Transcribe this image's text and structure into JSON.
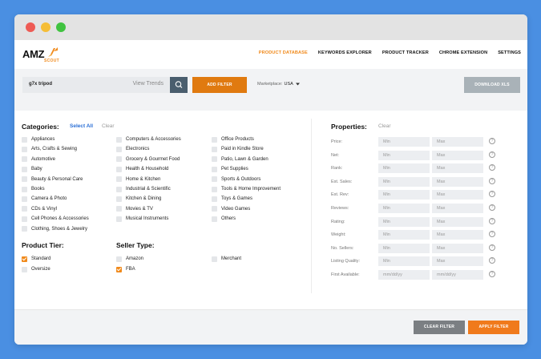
{
  "window": {
    "controls": [
      "close",
      "minimize",
      "maximize"
    ]
  },
  "logo": {
    "text_main": "AMZ",
    "text_sub": "SCOUT"
  },
  "nav": {
    "items": [
      {
        "label": "PRODUCT DATABASE",
        "active": true
      },
      {
        "label": "KEYWORDS EXPLORER",
        "active": false
      },
      {
        "label": "PRODUCT TRACKER",
        "active": false
      },
      {
        "label": "CHROME EXTENSION",
        "active": false
      },
      {
        "label": "SETTINGS",
        "active": false
      }
    ]
  },
  "search": {
    "value": "g7x tripod",
    "view_trends": "View Trends",
    "icon": "search-icon",
    "add_filter": "ADD FILTER",
    "marketplace_label": "Marketplace:",
    "marketplace_value": "USA",
    "download": "DOWNLOAD XLS"
  },
  "categories": {
    "title": "Categories:",
    "select_all": "Select All",
    "clear": "Clear",
    "col1": [
      "Appliances",
      "Arts, Crafts & Sewing",
      "Automotive",
      "Baby",
      "Beauty & Personal Care",
      "Books",
      "Camera & Photo",
      "CDs & Vinyl",
      "Cell Phones & Accessories",
      "Clothing, Shoes & Jewelry"
    ],
    "col2": [
      "Computers & Accessories",
      "Electronics",
      "Grocery & Gourmet Food",
      "Health & Household",
      "Home & Kitchen",
      "Industrial & Scientific",
      "Kitchen & Dining",
      "Movies & TV",
      "Musical Instruments"
    ],
    "col3": [
      "Office Products",
      "Paid in Kindle Store",
      "Patio, Lawn & Garden",
      "Pet Supplies",
      "Sports & Outdoors",
      "Tools & Home Improvement",
      "Toys & Games",
      "Video Games",
      "Others"
    ]
  },
  "product_tier": {
    "title": "Product Tier:",
    "items": [
      {
        "label": "Standard",
        "checked": true
      },
      {
        "label": "Oversize",
        "checked": false
      }
    ]
  },
  "seller_type": {
    "title": "Seller Type:",
    "items": [
      {
        "label": "Amazon",
        "checked": false
      },
      {
        "label": "FBA",
        "checked": true
      },
      {
        "label": "Merchant",
        "checked": false
      }
    ]
  },
  "properties": {
    "title": "Properties:",
    "clear": "Clear",
    "rows": [
      {
        "label": "Price:",
        "min": "Min",
        "max": "Max"
      },
      {
        "label": "Net:",
        "min": "Min",
        "max": "Max"
      },
      {
        "label": "Rank:",
        "min": "Min",
        "max": "Max"
      },
      {
        "label": "Est. Sales:",
        "min": "Min",
        "max": "Max"
      },
      {
        "label": "Est. Rev:",
        "min": "Min",
        "max": "Max"
      },
      {
        "label": "Reviews:",
        "min": "Min",
        "max": "Max"
      },
      {
        "label": "Rating:",
        "min": "Min",
        "max": "Max"
      },
      {
        "label": "Weight:",
        "min": "Min",
        "max": "Max"
      },
      {
        "label": "No. Sellers:",
        "min": "Min",
        "max": "Max"
      },
      {
        "label": "Listing Quality:",
        "min": "Min",
        "max": "Max"
      },
      {
        "label": "First Available:",
        "min": "mm/dd/yy",
        "max": "mm/dd/yy"
      }
    ],
    "help_glyph": "?"
  },
  "footer": {
    "clear_filter": "CLEAR FILTER",
    "apply_filter": "APPLY FILTER"
  },
  "colors": {
    "accent": "#f08a1c",
    "link": "#2a6fd6",
    "background": "#4a8fe2"
  }
}
